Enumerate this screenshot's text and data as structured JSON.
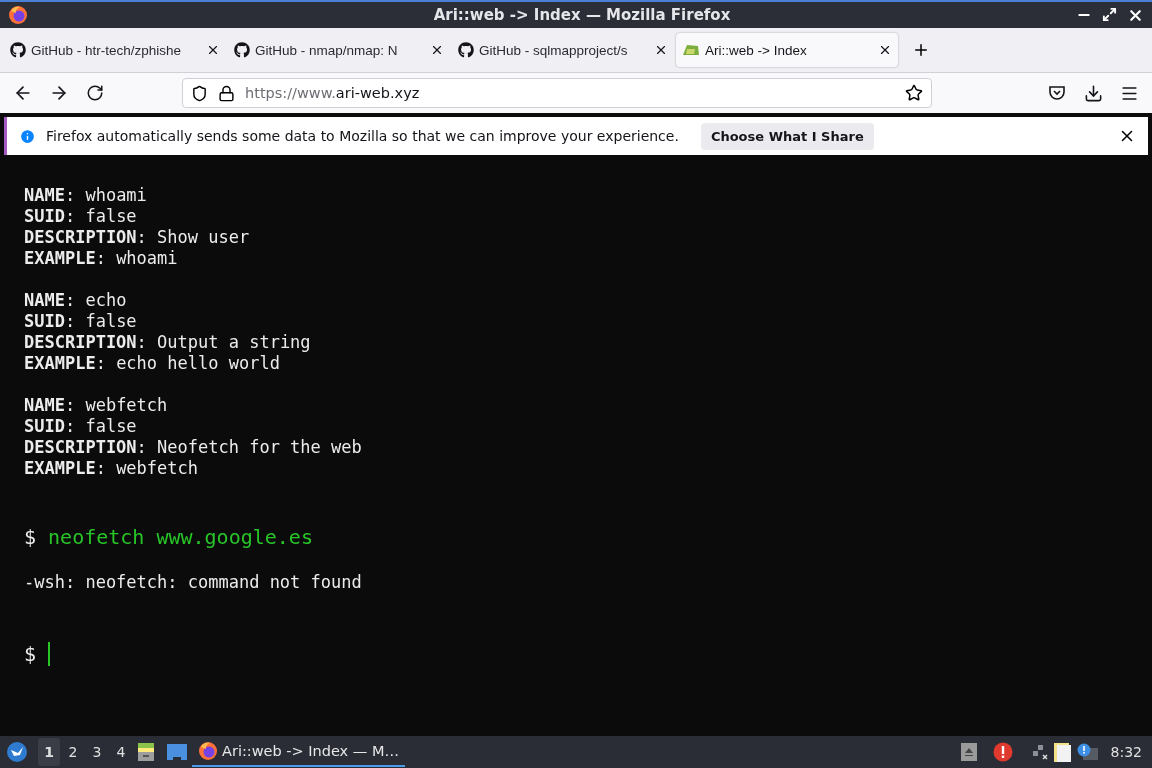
{
  "window": {
    "title": "Ari::web -> Index — Mozilla Firefox"
  },
  "tabs": [
    {
      "label": "GitHub - htr-tech/zphishe",
      "kind": "github",
      "selected": false
    },
    {
      "label": "GitHub - nmap/nmap: N",
      "kind": "github",
      "selected": false
    },
    {
      "label": "GitHub - sqlmapproject/s",
      "kind": "github",
      "selected": false
    },
    {
      "label": "Ari::web -> Index",
      "kind": "site",
      "selected": true
    }
  ],
  "address_bar": {
    "url_prefix": "https://www.",
    "url_domain": "ari-web.xyz"
  },
  "notification": {
    "text": "Firefox automatically sends some data to Mozilla so that we can improve your experience.",
    "button": "Choose What I Share"
  },
  "terminal": {
    "entries": [
      {
        "lines": [
          "**NAME**: whoami",
          "**SUID**: false",
          "**DESCRIPTION**: Show user",
          "**EXAMPLE**: whoami"
        ]
      },
      {
        "lines": [
          "**NAME**: echo",
          "**SUID**: false",
          "**DESCRIPTION**: Output a string",
          "**EXAMPLE**: echo hello world"
        ]
      },
      {
        "lines": [
          "**NAME**: webfetch",
          "**SUID**: false",
          "**DESCRIPTION**: Neofetch for the web",
          "**EXAMPLE**: webfetch"
        ]
      }
    ],
    "command": {
      "prompt": "$",
      "text": "neofetch www.google.es"
    },
    "output": "-wsh: neofetch: command not found",
    "input": {
      "prompt": "$",
      "cursor": true
    }
  },
  "taskbar": {
    "workspaces": [
      {
        "label": "1",
        "selected": true
      },
      {
        "label": "2",
        "selected": false
      },
      {
        "label": "3",
        "selected": false
      },
      {
        "label": "4",
        "selected": false
      }
    ],
    "task": "Ari::web -> Index — M…",
    "clock": "8:32"
  }
}
